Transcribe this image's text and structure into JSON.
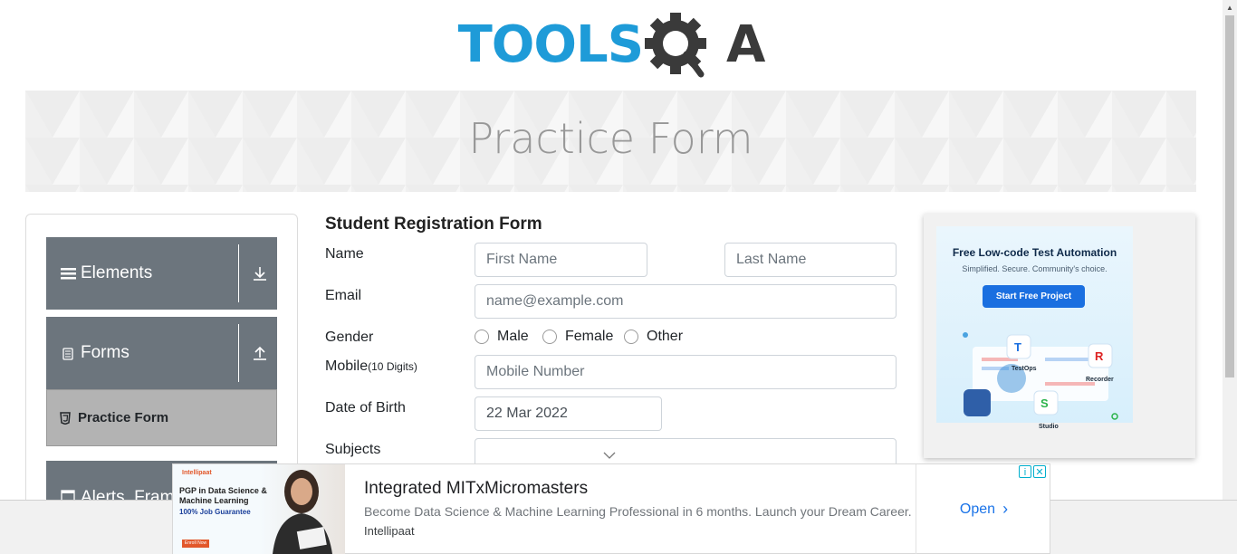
{
  "header": {
    "logo_tools": "TOOLS",
    "logo_a": "A"
  },
  "banner": {
    "title": "Practice Form"
  },
  "sidebar": {
    "groups": [
      {
        "label": "Elements",
        "toggle": "download-arrow"
      },
      {
        "label": "Forms",
        "toggle": "upload-arrow"
      },
      {
        "label": "Alerts, Frame & Windows"
      }
    ],
    "active_item": "Practice Form"
  },
  "form": {
    "title": "Student Registration Form",
    "name_label": "Name",
    "first_name_placeholder": "First Name",
    "last_name_placeholder": "Last Name",
    "email_label": "Email",
    "email_placeholder": "name@example.com",
    "gender_label": "Gender",
    "gender_options": [
      "Male",
      "Female",
      "Other"
    ],
    "mobile_label": "Mobile",
    "mobile_hint": "(10 Digits)",
    "mobile_placeholder": "Mobile Number",
    "dob_label": "Date of Birth",
    "dob_value": "22 Mar 2022",
    "subjects_label": "Subjects"
  },
  "side_ad": {
    "headline": "Free Low-code Test Automation",
    "subline": "Simplified. Secure. Community's choice.",
    "button": "Start Free Project",
    "tags": [
      "TestOps",
      "Recorder",
      "Studio"
    ]
  },
  "bottom_ad": {
    "image_brand": "Intellipaat",
    "image_line1": "PGP in Data Science &",
    "image_line2": "Machine Learning",
    "image_line3": "100% Job Guarantee",
    "image_button": "Enroll Now",
    "title": "Integrated MITxMicromasters",
    "description": "Become Data Science & Machine Learning Professional in 6 months. Launch your Dream Career.",
    "brand": "Intellipaat",
    "open_label": "Open"
  },
  "colors": {
    "brand_blue": "#1e9bd8",
    "brand_dark": "#3a3a3a",
    "sidebar_group": "#6c757d",
    "sidebar_active": "#b3b3b3",
    "link_blue": "#1a73e8"
  }
}
